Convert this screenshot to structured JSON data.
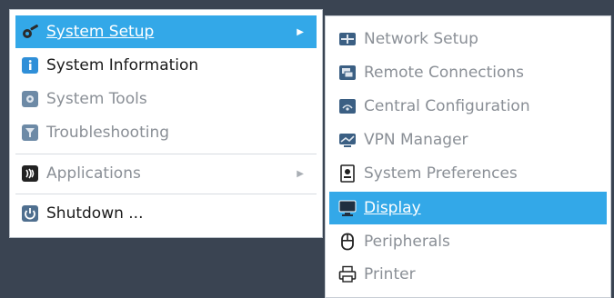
{
  "main_menu": {
    "items": [
      {
        "label": "System Setup",
        "icon": "gear-wrench-icon",
        "selected": true,
        "disabled": false,
        "has_submenu": true
      },
      {
        "label": "System Information",
        "icon": "info-icon",
        "selected": false,
        "disabled": false,
        "has_submenu": false
      },
      {
        "label": "System Tools",
        "icon": "tools-icon",
        "selected": false,
        "disabled": true,
        "has_submenu": false
      },
      {
        "label": "Troubleshooting",
        "icon": "troubleshooting-icon",
        "selected": false,
        "disabled": true,
        "has_submenu": false
      },
      {
        "label": "Applications",
        "icon": "applications-icon",
        "selected": false,
        "disabled": true,
        "has_submenu": true
      },
      {
        "label": "Shutdown ...",
        "icon": "power-icon",
        "selected": false,
        "disabled": false,
        "has_submenu": false
      }
    ]
  },
  "submenu": {
    "items": [
      {
        "label": "Network Setup",
        "icon": "network-icon",
        "selected": false,
        "disabled": true
      },
      {
        "label": "Remote Connections",
        "icon": "remote-connections-icon",
        "selected": false,
        "disabled": true
      },
      {
        "label": "Central Configuration",
        "icon": "central-configuration-icon",
        "selected": false,
        "disabled": true
      },
      {
        "label": "VPN Manager",
        "icon": "vpn-icon",
        "selected": false,
        "disabled": true
      },
      {
        "label": "System Preferences",
        "icon": "preferences-icon",
        "selected": false,
        "disabled": true
      },
      {
        "label": "Display",
        "icon": "display-icon",
        "selected": true,
        "disabled": false
      },
      {
        "label": "Peripherals",
        "icon": "mouse-icon",
        "selected": false,
        "disabled": true
      },
      {
        "label": "Printer",
        "icon": "printer-icon",
        "selected": false,
        "disabled": true
      }
    ]
  },
  "colors": {
    "selection": "#33a8e8",
    "background": "#3a4452",
    "disabled_text": "#8a8f96"
  }
}
